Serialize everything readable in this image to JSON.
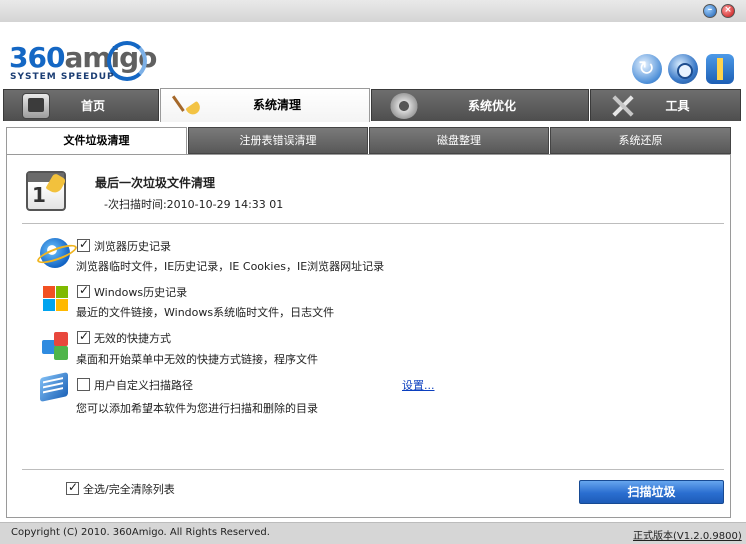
{
  "window": {
    "minimize_icon": "minimize-icon",
    "close_icon": "close-icon"
  },
  "logo": {
    "brand_360": "360",
    "brand_amigo": "amigo",
    "subtitle": "SYSTEM SPEEDUP"
  },
  "header_icons": [
    "refresh-icon",
    "settings-gear-icon",
    "life-vest-icon"
  ],
  "nav": {
    "tabs": [
      {
        "label": "首页",
        "icon": "home-icon",
        "active": false
      },
      {
        "label": "系统清理",
        "icon": "broom-icon",
        "active": true
      },
      {
        "label": "系统优化",
        "icon": "cog-icon",
        "active": false
      },
      {
        "label": "工具",
        "icon": "tools-icon",
        "active": false
      }
    ]
  },
  "subtabs": [
    {
      "label": "文件垃圾清理",
      "active": true
    },
    {
      "label": "注册表错误清理",
      "active": false
    },
    {
      "label": "磁盘整理",
      "active": false
    },
    {
      "label": "系统还原",
      "active": false
    }
  ],
  "last_clean": {
    "title": "最后一次垃圾文件清理",
    "scan_time": "-次扫描时间:2010-10-29 14:33 01",
    "icon": "calendar-broom-icon"
  },
  "options": [
    {
      "label": "浏览器历史记录",
      "desc": "浏览器临时文件，IE历史记录，IE Cookies，IE浏览器网址记录",
      "checked": true,
      "icon": "ie-browser-icon"
    },
    {
      "label": "Windows历史记录",
      "desc": "最近的文件链接，Windows系统临时文件，日志文件",
      "checked": true,
      "icon": "windows-icon"
    },
    {
      "label": "无效的快捷方式",
      "desc": "桌面和开始菜单中无效的快捷方式链接，程序文件",
      "checked": true,
      "icon": "blocks-icon"
    },
    {
      "label": "用户自定义扫描路径",
      "desc": "您可以添加希望本软件为您进行扫描和删除的目录",
      "checked": false,
      "icon": "book-icon"
    }
  ],
  "settings_link": "设置...",
  "footer": {
    "select_all_label": "全选/完全清除列表",
    "select_all_checked": true,
    "scan_button": "扫描垃圾"
  },
  "status": {
    "copyright": "Copyright (C) 2010. 360Amigo. All Rights Reserved.",
    "version": "正式版本(V1.2.0.9800)"
  }
}
